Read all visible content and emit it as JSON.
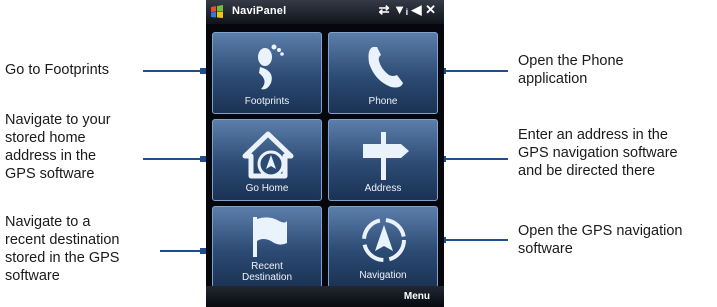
{
  "phone": {
    "title": "NaviPanel",
    "status_icons": "⇄ ▼ᵢ ◀ ✕",
    "menu_label": "Menu",
    "tiles": [
      {
        "label": "Footprints",
        "icon": "footprint-icon"
      },
      {
        "label": "Phone",
        "icon": "phone-handset-icon"
      },
      {
        "label": "Go Home",
        "icon": "home-icon"
      },
      {
        "label": "Address",
        "icon": "signpost-icon"
      },
      {
        "label": "Recent\nDestination",
        "icon": "flag-icon"
      },
      {
        "label": "Navigation",
        "icon": "compass-arrow-icon"
      }
    ]
  },
  "callouts": {
    "footprints": "Go to Footprints",
    "home": "Navigate to your\nstored home\naddress in the\nGPS software",
    "recent": "Navigate to a\nrecent destination\nstored in the GPS\nsoftware",
    "phone": "Open the Phone\napplication",
    "address": "Enter an address in the\nGPS navigation software\nand be directed there",
    "navigation": "Open the GPS navigation\nsoftware"
  },
  "colors": {
    "accent_line": "#1f4e8c",
    "tile_top": "#5b7eaa",
    "tile_bottom": "#1b3253"
  }
}
